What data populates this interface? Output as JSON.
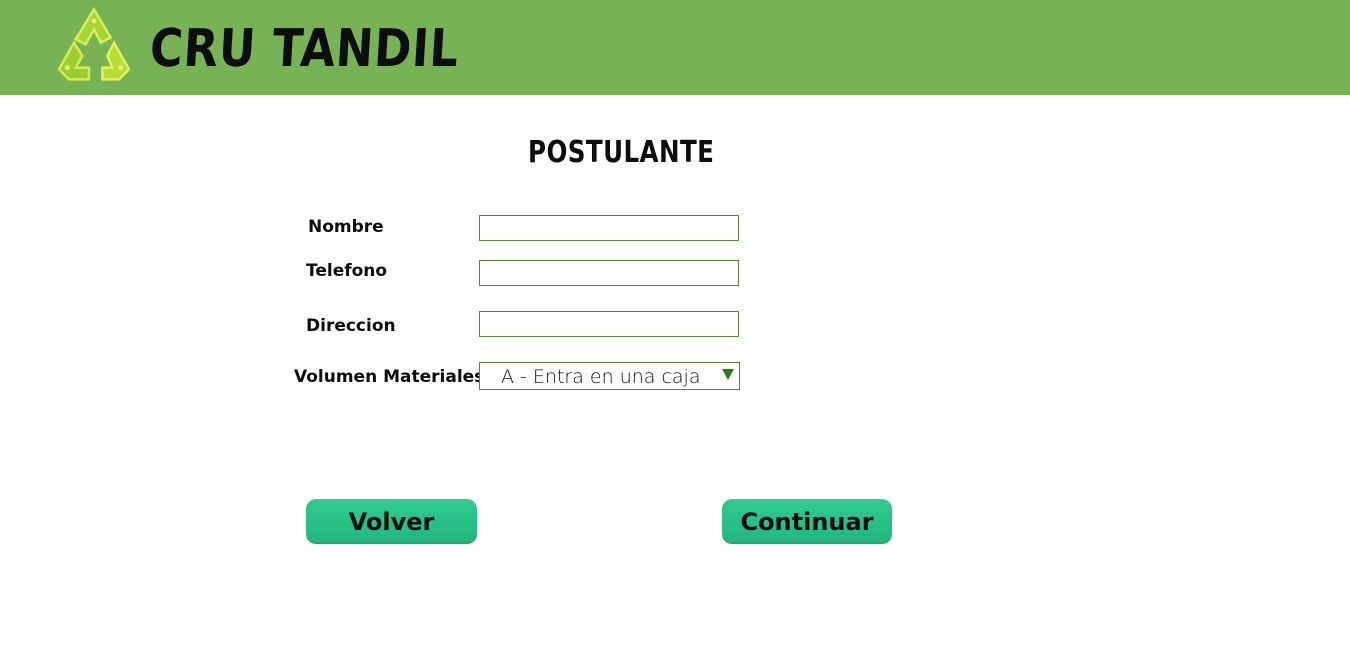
{
  "header": {
    "brand": "CRU TANDIL",
    "logo_icon": "recycle-icon",
    "background": "#77b255"
  },
  "page_title": "POSTULANTE",
  "form": {
    "nombre_label": "Nombre",
    "nombre_value": "",
    "telefono_label": "Telefono",
    "telefono_value": "",
    "direccion_label": "Direccion",
    "direccion_value": "",
    "volumen_label": "Volumen Materiales",
    "volumen_selected": "A - Entra en una caja"
  },
  "buttons": {
    "volver": "Volver",
    "continuar": "Continuar",
    "color": "#2bc188"
  }
}
